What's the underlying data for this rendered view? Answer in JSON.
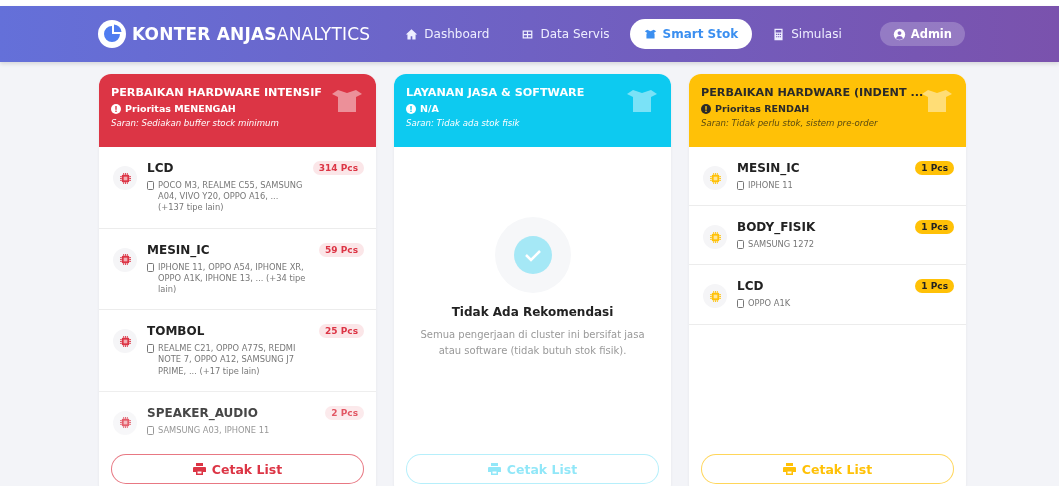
{
  "brand": {
    "bold": "KONTER ANJAS",
    "light": "ANALYTICS"
  },
  "nav": [
    {
      "label": "Dashboard",
      "selected": false
    },
    {
      "label": "Data Servis",
      "selected": false
    },
    {
      "label": "Smart Stok",
      "selected": true
    },
    {
      "label": "Simulasi",
      "selected": false
    }
  ],
  "user": {
    "label": "Admin"
  },
  "clusters": [
    {
      "title": "PERBAIKAN HARDWARE INTENSIF",
      "priority": "Prioritas MENENGAH",
      "advice": "Saran: Sediakan buffer stock minimum",
      "color": "#dc3545",
      "kind": "light-text",
      "button": "Cetak List",
      "items": [
        {
          "name": "LCD",
          "count": "314 Pcs",
          "models": "POCO M3, REALME C55, SAMSUNG A04, VIVO Y20, OPPO A16, ... (+137 tipe lain)"
        },
        {
          "name": "MESIN_IC",
          "count": "59 Pcs",
          "models": "IPHONE 11, OPPO A54, IPHONE XR, OPPO A1K, IPHONE 13, ... (+34 tipe lain)"
        },
        {
          "name": "TOMBOL",
          "count": "25 Pcs",
          "models": "REALME C21, OPPO A77S, REDMI NOTE 7, OPPO A12, SAMSUNG J7 PRIME, ... (+17 tipe lain)"
        },
        {
          "name": "SPEAKER_AUDIO",
          "count": "2 Pcs",
          "models": "SAMSUNG A03, IPHONE 11"
        }
      ]
    },
    {
      "title": "LAYANAN JASA & SOFTWARE",
      "priority": "N/A",
      "advice": "Saran: Tidak ada stok fisik",
      "color": "#0dcaf0",
      "kind": "light-text",
      "button": "Cetak List",
      "empty": {
        "title": "Tidak Ada Rekomendasi",
        "message": "Semua pengerjaan di cluster ini bersifat jasa atau software (tidak butuh stok fisik)."
      }
    },
    {
      "title": "PERBAIKAN HARDWARE (INDENT ...",
      "priority": "Prioritas RENDAH",
      "advice": "Saran: Tidak perlu stok, sistem pre-order",
      "color": "#ffc107",
      "kind": "dark-text",
      "button": "Cetak List",
      "items": [
        {
          "name": "MESIN_IC",
          "count": "1 Pcs",
          "models": "IPHONE 11"
        },
        {
          "name": "BODY_FISIK",
          "count": "1 Pcs",
          "models": "SAMSUNG 1272"
        },
        {
          "name": "LCD",
          "count": "1 Pcs",
          "models": "OPPO A1K"
        }
      ]
    }
  ]
}
